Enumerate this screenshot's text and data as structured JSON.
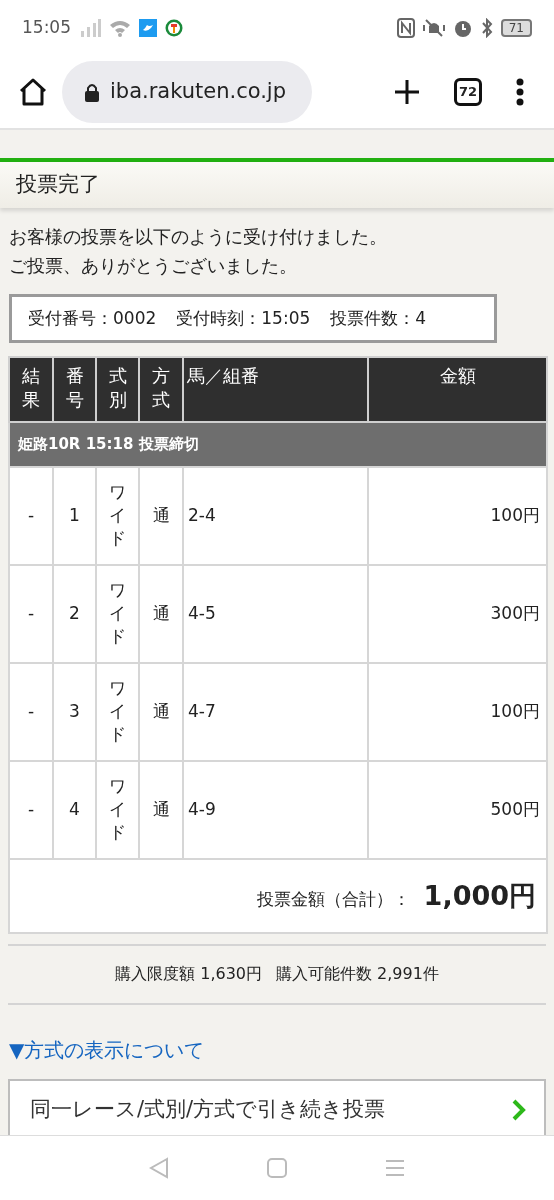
{
  "status_bar": {
    "time": "15:05",
    "battery": "71"
  },
  "browser": {
    "url": "iba.rakuten.co.jp",
    "tab_count": "72"
  },
  "page_title": "投票完了",
  "message": [
    "お客様の投票を以下のように受け付けました。",
    "ご投票、ありがとうございました。"
  ],
  "receipt": [
    {
      "label": "受付番号：",
      "value": "0002"
    },
    {
      "label": "受付時刻：",
      "value": "15:05"
    },
    {
      "label": "投票件数：",
      "value": "4"
    }
  ],
  "table": {
    "columns": [
      "結果",
      "番号",
      "式別",
      "方式",
      "馬／組番",
      "金額"
    ],
    "race_header": "姫路10R 15:18 投票締切",
    "rows": [
      {
        "result": "-",
        "number": "1",
        "type": "ワイド",
        "method": "通",
        "horses": "2-4",
        "amount": "100円"
      },
      {
        "result": "-",
        "number": "2",
        "type": "ワイド",
        "method": "通",
        "horses": "4-5",
        "amount": "300円"
      },
      {
        "result": "-",
        "number": "3",
        "type": "ワイド",
        "method": "通",
        "horses": "4-7",
        "amount": "100円"
      },
      {
        "result": "-",
        "number": "4",
        "type": "ワイド",
        "method": "通",
        "horses": "4-9",
        "amount": "500円"
      }
    ],
    "total_label": "投票金額（合計）：",
    "total_value": "1,000円"
  },
  "limits": [
    {
      "label": "購入限度額",
      "value": "1,630円"
    },
    {
      "label": "購入可能件数",
      "value": "2,991件"
    }
  ],
  "method_link": "▼方式の表示について",
  "continue_button": "同一レース/式別/方式で引き続き投票"
}
